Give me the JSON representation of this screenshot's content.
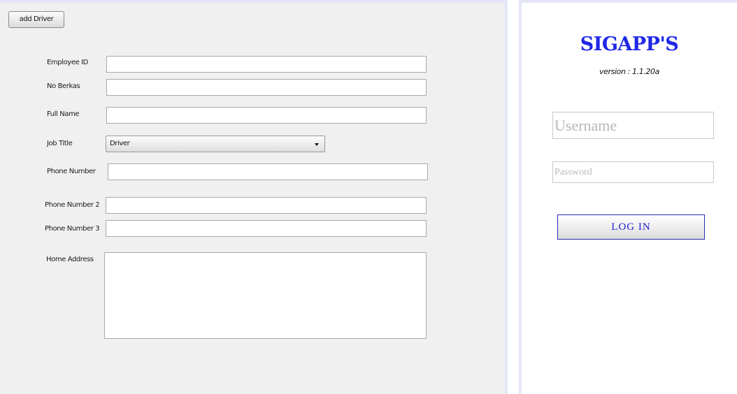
{
  "add_driver_form": {
    "add_button_label": "add Driver",
    "fields": {
      "employee_id": {
        "label": "Employee ID",
        "value": ""
      },
      "no_berkas": {
        "label": "No Berkas",
        "value": ""
      },
      "full_name": {
        "label": "Full Name",
        "value": ""
      },
      "job_title": {
        "label": "Job Title",
        "selected": "Driver"
      },
      "phone_number": {
        "label": "Phone Number",
        "value": ""
      },
      "phone_number_2": {
        "label": "Phone Number 2",
        "value": ""
      },
      "phone_number_3": {
        "label": "Phone Number 3",
        "value": ""
      },
      "home_address": {
        "label": "Home Address",
        "value": ""
      }
    }
  },
  "login": {
    "app_title": "SIGAPP'S",
    "version": "version : 1.1.20a",
    "username_placeholder": "Username",
    "password_placeholder": "Password",
    "login_button_label": "LOG IN",
    "accent_color": "#1f28e6"
  },
  "icons": {
    "dropdown": "chevron-down-icon"
  }
}
